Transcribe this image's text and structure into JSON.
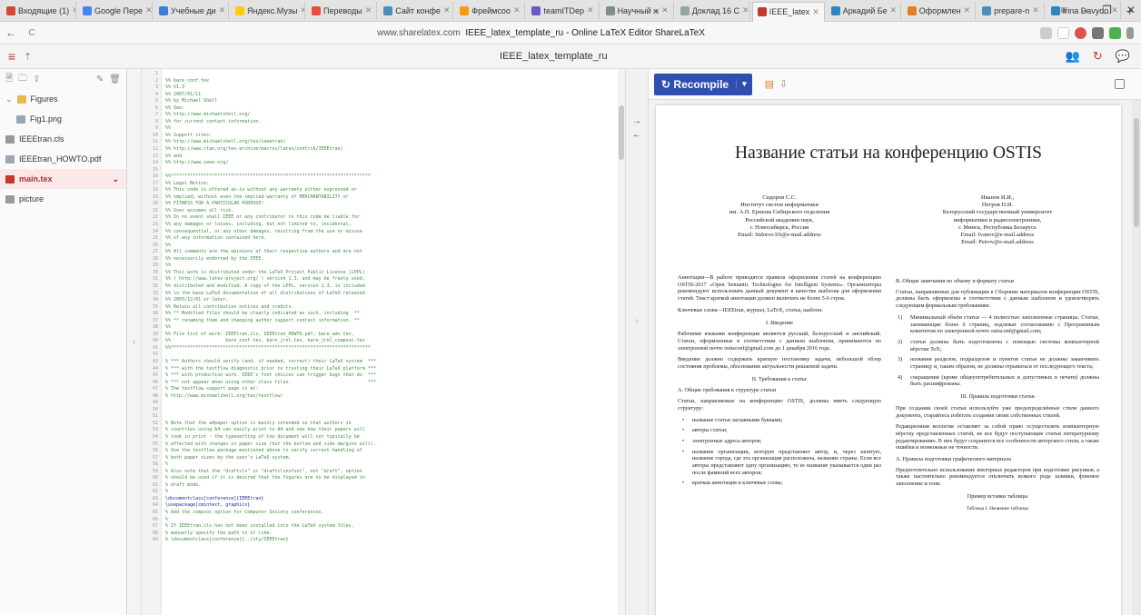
{
  "browser": {
    "tabs": [
      {
        "label": "Входящие (1)",
        "color": "#d44638"
      },
      {
        "label": "Google Пере",
        "color": "#4285f4"
      },
      {
        "label": "Учебные ди",
        "color": "#3b7dd8"
      },
      {
        "label": "Яндекс.Музы",
        "color": "#ffcc00"
      },
      {
        "label": "Переводы",
        "color": "#e74c3c"
      },
      {
        "label": "Сайт конфе",
        "color": "#4a90b8"
      },
      {
        "label": "Фреймсоо",
        "color": "#f39c12"
      },
      {
        "label": "teamITDep",
        "color": "#6a5acd"
      },
      {
        "label": "Научный ж",
        "color": "#7f8c8d"
      },
      {
        "label": "Доклад 16 С",
        "color": "#95a5a6"
      },
      {
        "label": "IEEE_latex",
        "color": "#c0392b",
        "active": true
      },
      {
        "label": "Аркадий Бе",
        "color": "#2e86c1"
      },
      {
        "label": "Оформлен",
        "color": "#e67e22"
      },
      {
        "label": "prepare-n",
        "color": "#4a90b8"
      },
      {
        "label": "Irina Davydo",
        "color": "#2e86c1"
      }
    ],
    "new_tab": "+",
    "window_buttons": [
      "≡",
      "–",
      "❐",
      "✕"
    ],
    "back": "←",
    "reload": "C",
    "url_host": "www.sharelatex.com",
    "url_title": "IEEE_latex_template_ru - Online LaTeX Editor ShareLaTeX"
  },
  "toolbar": {
    "menu_icon": "≡",
    "up_icon": "⇡",
    "project_title": "IEEE_latex_template_ru",
    "icons": [
      "👥",
      "↻",
      "💬"
    ]
  },
  "sidebar": {
    "tool_icons": [
      "🗎",
      "🗀",
      "⇪"
    ],
    "edit_icons": [
      "✎",
      "🗑"
    ],
    "items": [
      {
        "label": "Figures",
        "type": "folder",
        "level": 0
      },
      {
        "label": "Fig1.png",
        "type": "image",
        "level": 1
      },
      {
        "label": "IEEEtran.cls",
        "type": "file",
        "level": 0
      },
      {
        "label": "IEEEtran_HOWTO.pdf",
        "type": "image",
        "level": 0
      },
      {
        "label": "main.tex",
        "type": "file",
        "level": 0,
        "selected": true
      },
      {
        "label": "picture",
        "type": "file",
        "level": 0
      }
    ]
  },
  "editor": {
    "lines": [
      {
        "n": "1",
        "t": ""
      },
      {
        "n": "2",
        "t": "%% bare_conf.tex"
      },
      {
        "n": "3",
        "t": "%% V1.3"
      },
      {
        "n": "4",
        "t": "%% 2007/01/11"
      },
      {
        "n": "5",
        "t": "%% by Michael Shell"
      },
      {
        "n": "6",
        "t": "%% See:"
      },
      {
        "n": "7",
        "t": "%% http://www.michaelshell.org/"
      },
      {
        "n": "8",
        "t": "%% for current contact information."
      },
      {
        "n": "9",
        "t": "%%"
      },
      {
        "n": "10",
        "t": "%% Support sites:"
      },
      {
        "n": "11",
        "t": "%% http://www.michaelshell.org/tex/ieeetran/"
      },
      {
        "n": "12",
        "t": "%% http://www.ctan.org/tex-archive/macros/latex/contrib/IEEEtran/"
      },
      {
        "n": "13",
        "t": "%% and"
      },
      {
        "n": "14",
        "t": "%% http://www.ieee.org/"
      },
      {
        "n": "15",
        "t": ""
      },
      {
        "n": "16",
        "t": "%%*************************************************************************"
      },
      {
        "n": "17",
        "t": "%% Legal Notice:"
      },
      {
        "n": "18",
        "t": "%% This code is offered as-is without any warranty either expressed or"
      },
      {
        "n": "19",
        "t": "%% implied; without even the implied warranty of MERCHANTABILITY or"
      },
      {
        "n": "20",
        "t": "%% FITNESS FOR A PARTICULAR PURPOSE!"
      },
      {
        "n": "21",
        "t": "%% User assumes all risk."
      },
      {
        "n": "22",
        "t": "%% In no event shall IEEE or any contributor to this code be liable for"
      },
      {
        "n": "23",
        "t": "%% any damages or losses, including, but not limited to, incidental,"
      },
      {
        "n": "24",
        "t": "%% consequential, or any other damages, resulting from the use or misuse"
      },
      {
        "n": "25",
        "t": "%% of any information contained here."
      },
      {
        "n": "26",
        "t": "%%"
      },
      {
        "n": "27",
        "t": "%% All comments are the opinions of their respective authors and are not"
      },
      {
        "n": "28",
        "t": "%% necessarily endorsed by the IEEE."
      },
      {
        "n": "29",
        "t": "%%"
      },
      {
        "n": "30",
        "t": "%% This work is distributed under the LaTeX Project Public License (LPPL)"
      },
      {
        "n": "31",
        "t": "%% ( http://www.latex-project.org/ ) version 1.3, and may be freely used,"
      },
      {
        "n": "32",
        "t": "%% distributed and modified. A copy of the LPPL, version 1.3, is included"
      },
      {
        "n": "33",
        "t": "%% in the base LaTeX documentation of all distributions of LaTeX released"
      },
      {
        "n": "34",
        "t": "%% 2003/12/01 or later."
      },
      {
        "n": "35",
        "t": "%% Retain all contribution notices and credits."
      },
      {
        "n": "36",
        "t": "%% ** Modified files should be clearly indicated as such, including  **"
      },
      {
        "n": "37",
        "t": "%% ** renaming them and changing author support contact information. **"
      },
      {
        "n": "38",
        "t": "%%"
      },
      {
        "n": "39",
        "t": "%% File list of work: IEEEtran.cls, IEEEtran_HOWTO.pdf, bare_adv.tex,"
      },
      {
        "n": "40",
        "t": "%%                    bare_conf.tex, bare_jrnl.tex, bare_jrnl_compsoc.tex"
      },
      {
        "n": "41",
        "t": "%%*************************************************************************"
      },
      {
        "n": "42",
        "t": ""
      },
      {
        "n": "43",
        "t": "% *** Authors should verify (and, if needed, correct) their LaTeX system  ***"
      },
      {
        "n": "44",
        "t": "% *** with the testflow diagnostic prior to trusting their LaTeX platform ***"
      },
      {
        "n": "45",
        "t": "% *** with production work. IEEE's font choices can trigger bugs that do  ***"
      },
      {
        "n": "46",
        "t": "% *** not appear when using other class files.                            ***"
      },
      {
        "n": "47",
        "t": "% The testflow support page is at:"
      },
      {
        "n": "48",
        "t": "% http://www.michaelshell.org/tex/testflow/"
      },
      {
        "n": "49",
        "t": ""
      },
      {
        "n": "50",
        "t": ""
      },
      {
        "n": "51",
        "t": ""
      },
      {
        "n": "52",
        "t": "% Note that the a4paper option is mainly intended so that authors in"
      },
      {
        "n": "53",
        "t": "% countries using A4 can easily print to A4 and see how their papers will"
      },
      {
        "n": "54",
        "t": "% look in print - the typesetting of the document will not typically be"
      },
      {
        "n": "55",
        "t": "% affected with changes in paper size (but the bottom and side margins will)."
      },
      {
        "n": "56",
        "t": "% Use the testflow package mentioned above to verify correct handling of"
      },
      {
        "n": "57",
        "t": "% both paper sizes by the user's LaTeX system."
      },
      {
        "n": "58",
        "t": "%"
      },
      {
        "n": "59",
        "t": "% Also note that the \"draftcls\" or \"draftclsnofoot\", not \"draft\", option"
      },
      {
        "n": "60",
        "t": "% should be used if it is desired that the figures are to be displayed in"
      },
      {
        "n": "61",
        "t": "% draft mode."
      },
      {
        "n": "62",
        "t": "%"
      },
      {
        "n": "63",
        "t": "\\documentclass[conference]{IEEEtran}",
        "code": true
      },
      {
        "n": "64",
        "t": "\\usepackage[cmintext, graphicx}",
        "code": true
      },
      {
        "n": "65",
        "t": "% Add the compsoc option for Computer Society conferences."
      },
      {
        "n": "66",
        "t": "%"
      },
      {
        "n": "67",
        "t": "% If IEEEtran.cls has not been installed into the LaTeX system files,"
      },
      {
        "n": "68",
        "t": "% manually specify the path to it like:"
      },
      {
        "n": "69",
        "t": "% \\documentclass[conference]{../sty/IEEEtran}"
      }
    ]
  },
  "splitter": {
    "icons": [
      "→",
      "←"
    ],
    "handle": "›"
  },
  "pdf_toolbar": {
    "recompile_label": "Recompile",
    "recompile_icon": "↻",
    "dropdown_icon": "▾",
    "icons": [
      "▤",
      "⇩"
    ]
  },
  "pdf": {
    "title": "Название статьи на конференцию OSTIS",
    "author_left": [
      "Сидоров С.С.",
      "Институт систем информатики",
      "им. А.П. Ершова Сибирского отделения",
      "Российской академии наук,",
      "г. Новосибирск, Россия",
      "Email: Sidorov.SS@e-mail.address"
    ],
    "author_right": [
      "Иванов И.И.,",
      "Петров П.И.",
      "Белорусский государственный университет",
      "информатики и радиоэлектроники,",
      "г. Минск, Республика Беларусь",
      "Email: Ivanov@e-mail.address",
      "Email: Petrov@e-mail.address"
    ],
    "left": {
      "abstract": "Аннотация—В работе приводятся правила оформления статей на конференцию OSTIS-2017 «Open Semantic Technologies for Intelligent Systems». Организаторы рекомендуют использовать данный документ в качестве шаблона для оформления статей. Текст краткой аннотации должен включать не более 5-6 строк.",
      "keywords": "Ключевые слова—IEEEtran, журнал, LaTeX, статья, шаблон.",
      "h1": "I. Введение",
      "p1": "Рабочими языками конференции являются русский, белорусский и английский. Статьи, оформленные в соответствии с данным шаблоном, принимаются по электронной почте ostisconf@gmail.com до 1 декабря 2016 года.",
      "p2": "Введение должно содержать краткую постановку задачи, небольшой обзор состояния проблемы, обоснование актуальности решаемой задачи.",
      "h2": "II. Требования к статье",
      "sh1": "A. Общие требования к структуре статьи",
      "p3": "Статьи, направляемые на конференцию OSTIS, должны иметь следующую структуру:",
      "bullets": [
        "название статьи заглавными буквами;",
        "авторы статьи;",
        "электронные адреса авторов;",
        "название организации, которую представляет автор, и, через запятую, название города, где эта организация расположена, название страны. Если все авторы представляют одну организацию, то ее название указывается один раз после фамилий всех авторов;",
        "краткая аннотация и ключевые слова;"
      ]
    },
    "right": {
      "sh1": "B. Общие замечания по объему и формату статьи",
      "p1": "Статьи, направляемые для публикации в Сборнике материалов конференции OSTIS, должны быть оформлены в соответствии с данным шаблоном и удовлетворять следующим формальным требованиям:",
      "items": [
        {
          "n": "1)",
          "t": "Минимальный объём статьи — 4 полностью заполненные страницы. Статьи, занимающие более 6 страниц, подлежат согласованию с Программным комитетом по электронной почте ostisconf@gmail.com;"
        },
        {
          "n": "2)",
          "t": "статьи должны быть подготовлены с помощью системы компьютерной вёрстки TeX;"
        },
        {
          "n": "3)",
          "t": "названия разделов, подразделов и пунктов статьи не должны заканчивать страницу и, таким образом, не должны отрываться от последующего текста;"
        },
        {
          "n": "4)",
          "t": "сокращения (кроме общеупотребительных и допустимых в печати) должны быть расшифрованы."
        }
      ],
      "h1": "III. Правила подготовки статьи",
      "p2": "При создании своей статьи используйте уже предопределённые стили данного документа, старайтесь избегать создания своих собственных стилей.",
      "p3": "Редакционная коллегия оставляет за собой право осуществлять компьютерную вёрстку представленных статей, не все будут поступающие статьи литературному редактированию. В них будут сохранятся все особенности авторского стиля, а также ошибки и возможные не точности.",
      "sh2": "A. Правила подготовки графического материала",
      "p4": "Предпочтительно использование векторных редакторов при подготовке рисунков, а также настоятельно рекомендуется отключить всякого рода заливки, фоновое заполнение и тени.",
      "p5": "Пример вставки таблицы",
      "p6": "Таблица I.   Название таблицы"
    }
  }
}
